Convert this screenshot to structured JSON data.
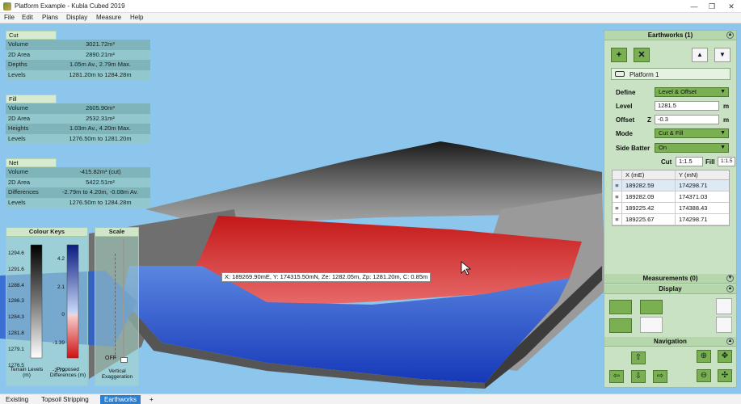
{
  "window": {
    "title": "Platform Example - Kubla Cubed 2019",
    "minimize": "—",
    "restore": "❐",
    "close": "✕"
  },
  "menu": [
    "File",
    "Edit",
    "Plans",
    "Display",
    "Measure",
    "Help"
  ],
  "cut": {
    "header": "Cut",
    "rows": [
      {
        "k": "Volume",
        "v": "3021.72m³"
      },
      {
        "k": "2D Area",
        "v": "2890.21m²"
      },
      {
        "k": "Depths",
        "v": "1.05m Av., 2.79m Max."
      },
      {
        "k": "Levels",
        "v": "1281.20m to 1284.28m"
      }
    ]
  },
  "fill": {
    "header": "Fill",
    "rows": [
      {
        "k": "Volume",
        "v": "2605.90m³"
      },
      {
        "k": "2D Area",
        "v": "2532.31m²"
      },
      {
        "k": "Heights",
        "v": "1.03m Av., 4.20m Max."
      },
      {
        "k": "Levels",
        "v": "1276.50m to 1281.20m"
      }
    ]
  },
  "net": {
    "header": "Net",
    "rows": [
      {
        "k": "Volume",
        "v": "-415.82m³ (cut)"
      },
      {
        "k": "2D Area",
        "v": "5422.51m²"
      },
      {
        "k": "Differences",
        "v": "-2.79m to 4.20m, -0.08m Av."
      },
      {
        "k": "Levels",
        "v": "1276.50m to 1284.28m"
      }
    ]
  },
  "colour_keys": {
    "title": "Colour Keys",
    "terrain_ticks": [
      "1294.6",
      "1291.6",
      "1288.4",
      "1286.3",
      "1284.3",
      "1281.8",
      "1279.1",
      "1276.5"
    ],
    "diff_ticks": [
      "4.2",
      "2.1",
      "0",
      "-1.39",
      "-2.79"
    ],
    "terrain_label": "Terrain Levels (m)",
    "diff_label": "Proposed Differences (m)"
  },
  "scale": {
    "title": "Scale",
    "off_label": "OFF",
    "caption": "Vertical Exaggeration",
    "value_fraction": 0.0
  },
  "earthworks": {
    "title": "Earthworks (1)",
    "add_icon": "+",
    "delete_icon": "✕",
    "up_icon": "▲",
    "down_icon": "▼",
    "platform_name": "Platform 1",
    "define_label": "Define",
    "define_value": "Level & Offset",
    "level_label": "Level",
    "level_value": "1281.5",
    "level_unit": "m",
    "offset_label": "Offset",
    "offset_z": "Z",
    "offset_value": "-0.3",
    "offset_unit": "m",
    "mode_label": "Mode",
    "mode_value": "Cut & Fill",
    "side_batter_label": "Side Batter",
    "side_batter_value": "On",
    "cut_label": "Cut",
    "cut_value": "1:1.5",
    "fill_label": "Fill",
    "fill_value": "1:1.5",
    "columns": [
      "X (mE)",
      "Y (mN)"
    ],
    "rows": [
      {
        "x": "189282.59",
        "y": "174298.71"
      },
      {
        "x": "189282.09",
        "y": "174371.03"
      },
      {
        "x": "189225.42",
        "y": "174388.43"
      },
      {
        "x": "189225.67",
        "y": "174298.71"
      }
    ]
  },
  "measurements": {
    "title": "Measurements (0)"
  },
  "display": {
    "title": "Display"
  },
  "navigation": {
    "title": "Navigation"
  },
  "tooltip": "X: 189269.90mE, Y: 174315.50mN, Ze: 1282.05m, Zp: 1281.20m, C: 0.85m",
  "tabs": [
    {
      "label": "Existing",
      "active": false
    },
    {
      "label": "Topsoil Stripping",
      "active": false
    },
    {
      "label": "Earthworks",
      "active": true
    },
    {
      "label": "+",
      "active": false
    }
  ],
  "colors": {
    "sky": "#8cc6ec",
    "panel_green": "#c9e2c3",
    "button_green": "#7ab052",
    "cut_red": "#e02020",
    "fill_blue": "#2050d8",
    "tab_active": "#2a7fd4"
  }
}
